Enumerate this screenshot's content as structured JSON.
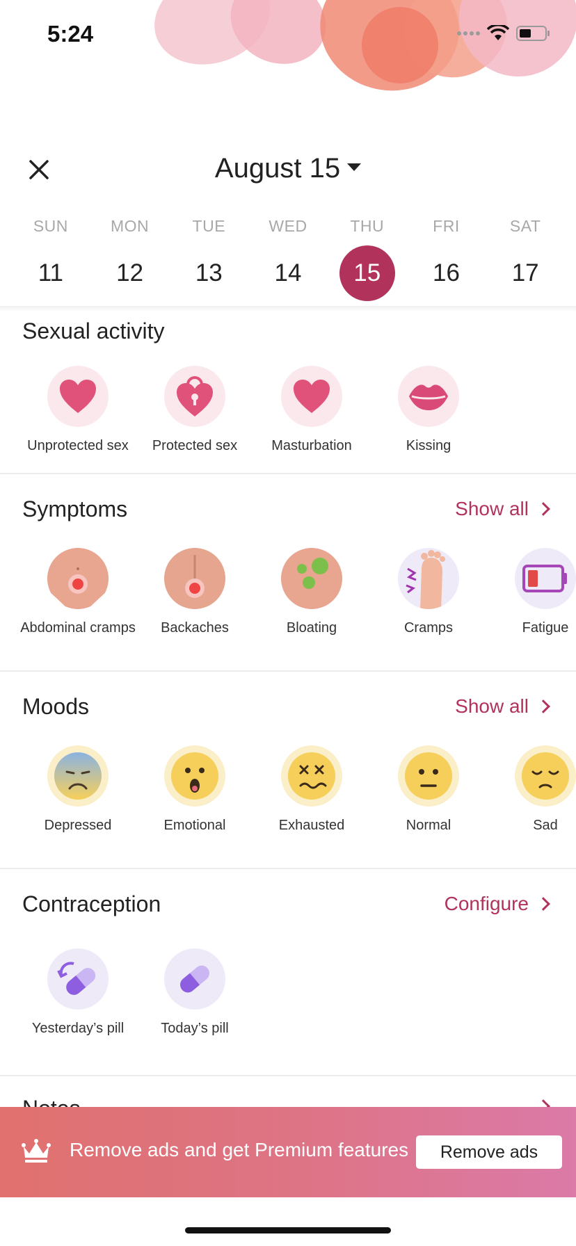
{
  "status": {
    "time": "5:24"
  },
  "header": {
    "date_title": "August 15"
  },
  "week": [
    {
      "name": "SUN",
      "num": "11"
    },
    {
      "name": "MON",
      "num": "12"
    },
    {
      "name": "TUE",
      "num": "13"
    },
    {
      "name": "WED",
      "num": "14"
    },
    {
      "name": "THU",
      "num": "15",
      "selected": true
    },
    {
      "name": "FRI",
      "num": "16"
    },
    {
      "name": "SAT",
      "num": "17"
    }
  ],
  "sexual_activity": {
    "title": "Sexual activity",
    "items": [
      "Unprotected sex",
      "Protected sex",
      "Masturbation",
      "Kissing"
    ]
  },
  "symptoms": {
    "title": "Symptoms",
    "link": "Show all",
    "items": [
      "Abdominal cramps",
      "Backaches",
      "Bloating",
      "Cramps",
      "Fatigue"
    ]
  },
  "moods": {
    "title": "Moods",
    "link": "Show all",
    "items": [
      "Depressed",
      "Emotional",
      "Exhausted",
      "Normal",
      "Sad"
    ]
  },
  "contraception": {
    "title": "Contraception",
    "link": "Configure",
    "items": [
      "Yesterday’s pill",
      "Today’s pill"
    ]
  },
  "notes": {
    "title": "Notes"
  },
  "banner": {
    "text": "Remove ads and get Premium features",
    "button": "Remove ads"
  },
  "colors": {
    "accent": "#b1335b",
    "banner_start": "#e0716e",
    "banner_end": "#dc7aa8"
  }
}
